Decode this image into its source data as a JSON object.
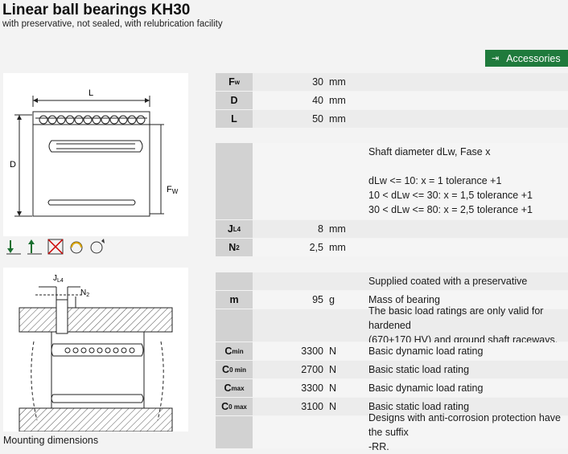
{
  "header": {
    "title": "Linear ball bearings KH30",
    "subtitle": "with preservative, not sealed, with relubrication facility"
  },
  "accessories_button": {
    "label": "Accessories",
    "icon": "login-arrow-icon"
  },
  "drawing_top": {
    "label_L": "L",
    "label_D": "D",
    "label_Fw": "F",
    "label_Fw_sub": "W"
  },
  "drawing_bottom": {
    "label_JL4": "J",
    "label_JL4_sub": "L4",
    "label_N2": "N",
    "label_N2_sub": "2"
  },
  "icons": [
    "radial-load-down-icon",
    "radial-load-up-icon",
    "not-sealed-icon",
    "relubrication-icon",
    "rotation-icon"
  ],
  "mounting_label": "Mounting dimensions",
  "specs": {
    "Fw": {
      "sym": "F",
      "sub": "w",
      "value": "30",
      "unit": "mm"
    },
    "D": {
      "sym": "D",
      "value": "40",
      "unit": "mm"
    },
    "L": {
      "sym": "L",
      "value": "50",
      "unit": "mm"
    },
    "shaft_note": [
      "Shaft diameter dLw, Fase x",
      "",
      "dLw <= 10: x = 1 tolerance +1",
      "10 < dLw <= 30: x = 1,5 tolerance +1",
      "30 < dLw <= 80: x = 2,5 tolerance +1"
    ],
    "JL4": {
      "sym": "J",
      "sub": "L4",
      "value": "8",
      "unit": "mm"
    },
    "N2": {
      "sym": "N",
      "sub": "2",
      "value": "2,5",
      "unit": "mm"
    },
    "coated": "Supplied coated with a preservative",
    "m": {
      "sym": "m",
      "value": "95",
      "unit": "g",
      "desc": "Mass of bearing"
    },
    "ratings_note_1": "The basic load ratings are only valid for hardened",
    "ratings_note_2": "(670+170 HV) and ground shaft raceways.",
    "Cmin": {
      "sym": "C",
      "sub": "min",
      "value": "3300",
      "unit": "N",
      "desc": "Basic dynamic load rating"
    },
    "C0min": {
      "sym": "C",
      "sub": "0 min",
      "value": "2700",
      "unit": "N",
      "desc": "Basic static load rating"
    },
    "Cmax": {
      "sym": "C",
      "sub": "max",
      "value": "3300",
      "unit": "N",
      "desc": "Basic dynamic load rating"
    },
    "C0max": {
      "sym": "C",
      "sub": "0 max",
      "value": "3100",
      "unit": "N",
      "desc": "Basic static load rating"
    },
    "rr_note_1": "Designs with anti-corrosion protection have the suffix",
    "rr_note_2": "-RR."
  }
}
